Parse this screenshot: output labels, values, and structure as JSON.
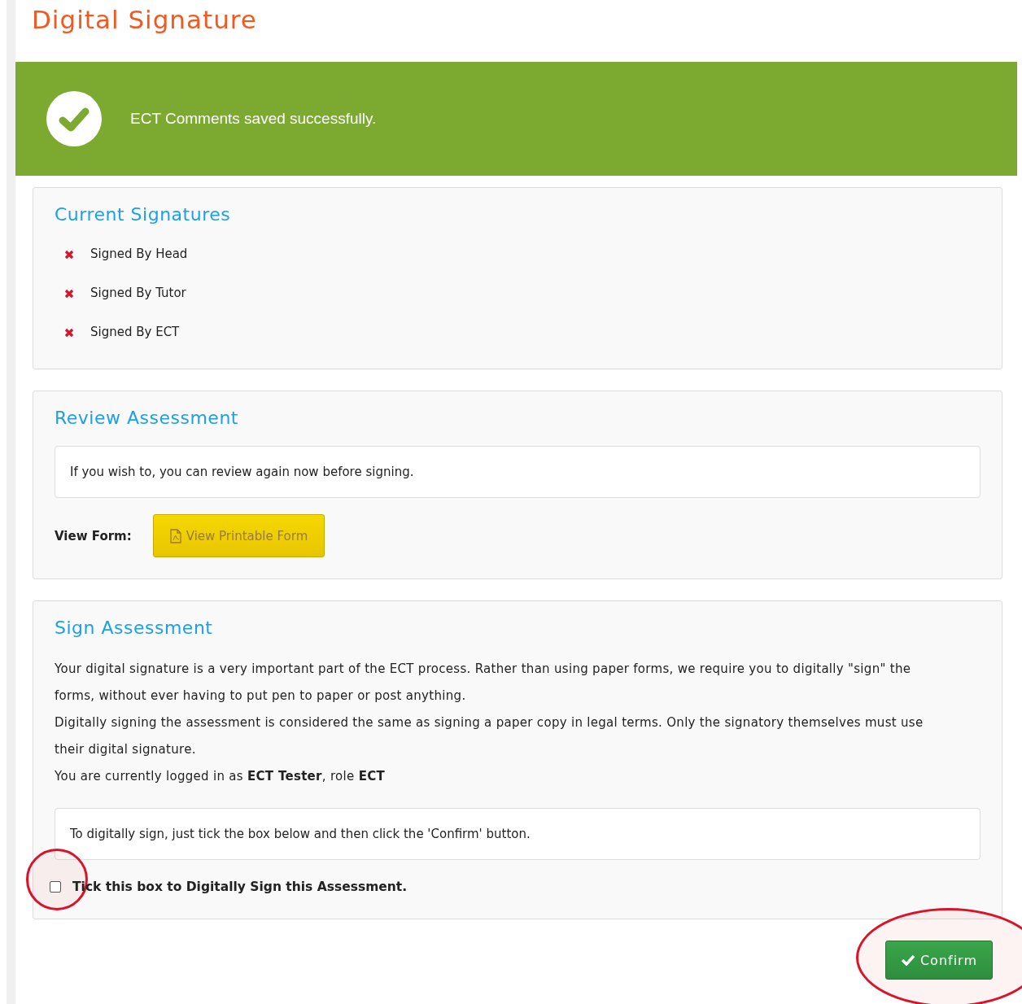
{
  "page_title": "Digital Signature",
  "alert": {
    "kind": "success",
    "message": "ECT Comments saved successfully."
  },
  "current_signatures": {
    "title": "Current Signatures",
    "items": [
      {
        "label": "Signed By Head",
        "signed": false
      },
      {
        "label": "Signed By Tutor",
        "signed": false
      },
      {
        "label": "Signed By ECT",
        "signed": false
      }
    ]
  },
  "review": {
    "title": "Review Assessment",
    "note": "If you wish to, you can review again now before signing.",
    "view_form_label": "View Form:",
    "button": "View Printable Form"
  },
  "sign": {
    "title": "Sign Assessment",
    "paragraphs": [
      "Your digital signature is a very important part of the ECT process. Rather than using paper forms, we require you to digitally \"sign\" the forms, without ever having to put pen to paper or post anything.",
      "Digitally signing the assessment is considered the same as signing a paper copy in legal terms. Only the signatory themselves must use their digital signature.",
      "You are currently logged in as **ECT Tester**, role **ECT**"
    ],
    "note": "To digitally sign, just tick the box below and then click the 'Confirm' button.",
    "checkbox": {
      "label": "Tick this box to Digitally Sign this Assessment.",
      "checked": false
    }
  },
  "confirm_button": "Confirm"
}
